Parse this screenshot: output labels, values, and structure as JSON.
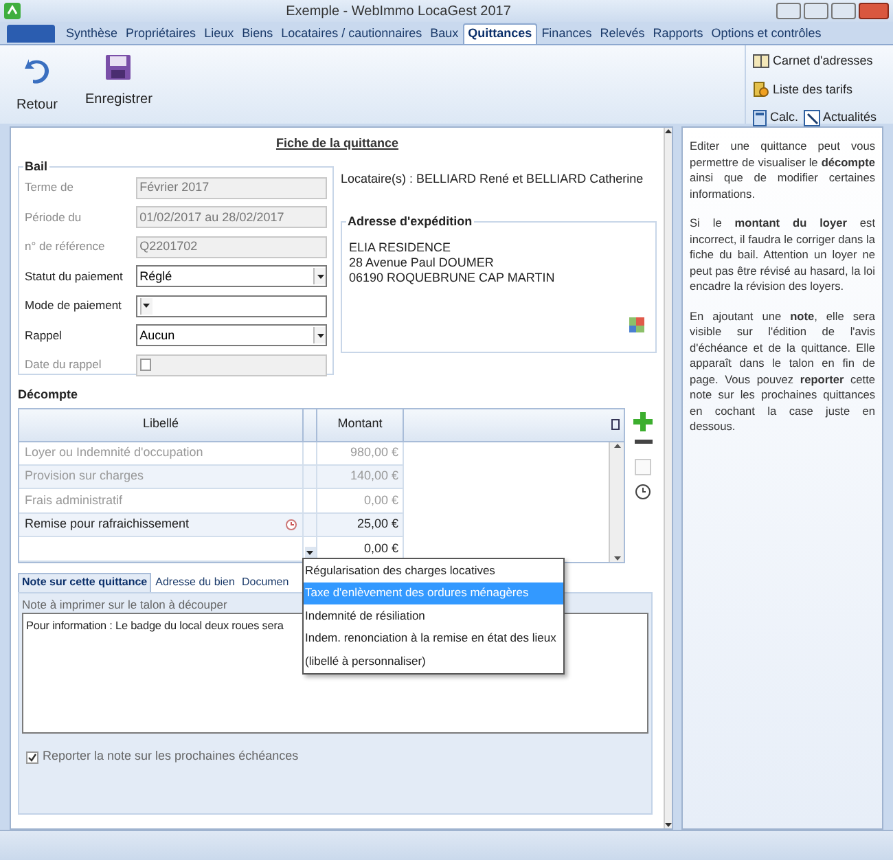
{
  "window": {
    "title": "Exemple - WebImmo LocaGest 2017"
  },
  "tabs": [
    {
      "label": "Synthèse",
      "selected": false
    },
    {
      "label": "Propriétaires",
      "selected": false
    },
    {
      "label": "Lieux",
      "selected": false
    },
    {
      "label": "Biens",
      "selected": false
    },
    {
      "label": "Locataires / cautionnaires",
      "selected": false
    },
    {
      "label": "Baux",
      "selected": false
    },
    {
      "label": "Quittances",
      "selected": true
    },
    {
      "label": "Finances",
      "selected": false
    },
    {
      "label": "Relevés",
      "selected": false
    },
    {
      "label": "Rapports",
      "selected": false
    },
    {
      "label": "Options et contrôles",
      "selected": false
    }
  ],
  "toolbar": {
    "actions": [
      {
        "label": "Retour",
        "kind": "back"
      },
      {
        "label": "Enregistrer",
        "kind": "save"
      }
    ],
    "links": [
      {
        "label": "Carnet d'adresses",
        "kind": "book"
      },
      {
        "label": "Liste des tarifs",
        "kind": "tariffs"
      },
      {
        "label": "Calc.",
        "kind": "calculator"
      },
      {
        "label": "Actualités",
        "kind": "news"
      }
    ]
  },
  "form": {
    "title": "Fiche de la quittance",
    "lease": {
      "title": "Bail",
      "fields": [
        {
          "label": "Terme de",
          "value": "Février 2017",
          "kind": "text",
          "disabled": true
        },
        {
          "label": "Période du",
          "value": "01/02/2017 au 28/02/2017",
          "kind": "text",
          "disabled": true
        },
        {
          "label": "n° de référence",
          "value": "Q2201702",
          "kind": "text",
          "disabled": true
        },
        {
          "label": "Statut du paiement",
          "value": "Réglé",
          "kind": "select",
          "disabled": false
        },
        {
          "label": "Mode de paiement",
          "kind": "select",
          "disabled": false
        },
        {
          "label": "Rappel",
          "value": "Aucun",
          "kind": "select",
          "disabled": false
        },
        {
          "label": "Date du rappel",
          "kind": "date",
          "disabled": true
        }
      ]
    },
    "tenants": "Locataire(s) : BELLIARD René et BELLIARD Catherine",
    "shipping": {
      "title": "Adresse d'expédition",
      "lines": [
        "ELIA RESIDENCE",
        "28 Avenue Paul DOUMER",
        "06190 ROQUEBRUNE CAP MARTIN"
      ]
    }
  },
  "statement": {
    "title": "Décompte",
    "columns": [
      "Libellé",
      "Montant"
    ],
    "rows": [
      {
        "label": "Loyer ou Indemnité d'occupation",
        "amount": "980,00 €",
        "kind": "fixed"
      },
      {
        "label": "Provision sur charges",
        "amount": "140,00 €",
        "kind": "fixed"
      },
      {
        "label": "Frais administratif",
        "amount": "0,00 €",
        "kind": "fixed"
      },
      {
        "label": "Remise pour rafraichissement",
        "amount": "25,00 €",
        "kind": "custom"
      },
      {
        "amount": "0,00 €",
        "kind": "new",
        "expanded": true
      }
    ],
    "options": [
      {
        "label": "Régularisation des charges locatives",
        "selected": false
      },
      {
        "label": "Taxe d'enlèvement des ordures ménagères",
        "selected": true
      },
      {
        "label": "Indemnité de résiliation",
        "selected": false
      },
      {
        "label": "Indem. renonciation à la remise en état des lieux",
        "selected": false
      },
      {
        "label": "(libellé à personnaliser)",
        "selected": false
      }
    ]
  },
  "bottom_tabs": [
    {
      "label": "Note sur cette quittance",
      "selected": true
    },
    {
      "label": "Adresse du bien",
      "selected": false
    },
    {
      "label": "Documen",
      "selected": false
    }
  ],
  "note": {
    "label": "Note à imprimer sur le talon à découper",
    "text": "Pour information : Le badge du local deux roues sera",
    "carry_over": {
      "label": "Reporter la note sur les prochaines échéances",
      "checked": true
    }
  },
  "help": [
    "Editer une quittance peut vous permettre de visualiser le **décompte** ainsi que de modifier certaines informations.",
    "Si le **montant du loyer** est incorrect, il faudra le corriger dans la fiche du bail. Attention un loyer ne peut pas être révisé au hasard, la loi encadre la révision des loyers.",
    "En ajoutant une **note**, elle sera visible sur l'édition de l'avis d'échéance et de la quittance. Elle apparaît dans le talon en fin de page. Vous pouvez **reporter** cette note sur les prochaines quittances en cochant la case juste en dessous."
  ]
}
